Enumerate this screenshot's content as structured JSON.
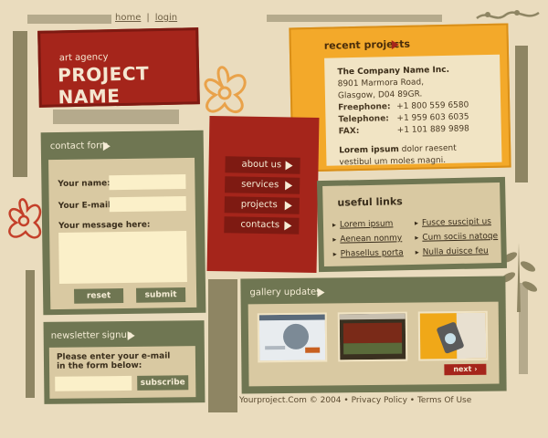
{
  "top_links": {
    "home": "home",
    "separator": "|",
    "login": "login"
  },
  "logo": {
    "tag": "art agency",
    "name": "PROJECT NAME"
  },
  "recent_projects": {
    "title": "recent projects",
    "company": "The Company Name Inc.",
    "address_line1": "8901 Marmora Road,",
    "address_line2": "Glasgow, D04 89GR.",
    "contacts": [
      {
        "label": "Freephone:",
        "value": "+1 800 559 6580"
      },
      {
        "label": "Telephone:",
        "value": "+1 959 603 6035"
      },
      {
        "label": "FAX:",
        "value": "+1 101 889 9898"
      }
    ],
    "lorem_bold": "Lorem ipsum",
    "lorem_text": "dolor raesent vestibul um moles magni."
  },
  "contact_form": {
    "title": "contact form",
    "name_label": "Your name:",
    "email_label": "Your E-mail:",
    "message_label": "Your message here:",
    "name_value": "",
    "email_value": "",
    "message_value": "",
    "reset_label": "reset",
    "submit_label": "submit"
  },
  "nav": {
    "items": [
      {
        "label": "about us"
      },
      {
        "label": "services"
      },
      {
        "label": "projects"
      },
      {
        "label": "contacts"
      }
    ]
  },
  "useful_links": {
    "title": "useful links",
    "links": [
      "Lorem ipsum",
      "Fusce suscipit us",
      "Aenean nonmy",
      "Cum sociis natoqe",
      "Phasellus porta",
      "Nulla duisce feu"
    ]
  },
  "gallery": {
    "title": "gallery updates",
    "next_label": "next"
  },
  "newsletter": {
    "title": "newsletter signup",
    "text_line1": "Please enter your e-mail",
    "text_line2": "in the form below:",
    "email_value": "",
    "subscribe_label": "subscribe"
  },
  "footer": {
    "copyright": "Yourproject.Com © 2004",
    "privacy": "Privacy Policy",
    "terms": "Terms Of Use",
    "bullet": "•"
  },
  "colors": {
    "background": "#eadcbe",
    "olive": "#6f7652",
    "red": "#a5251b",
    "orange": "#f3a92a",
    "panel": "#d9c9a2"
  }
}
